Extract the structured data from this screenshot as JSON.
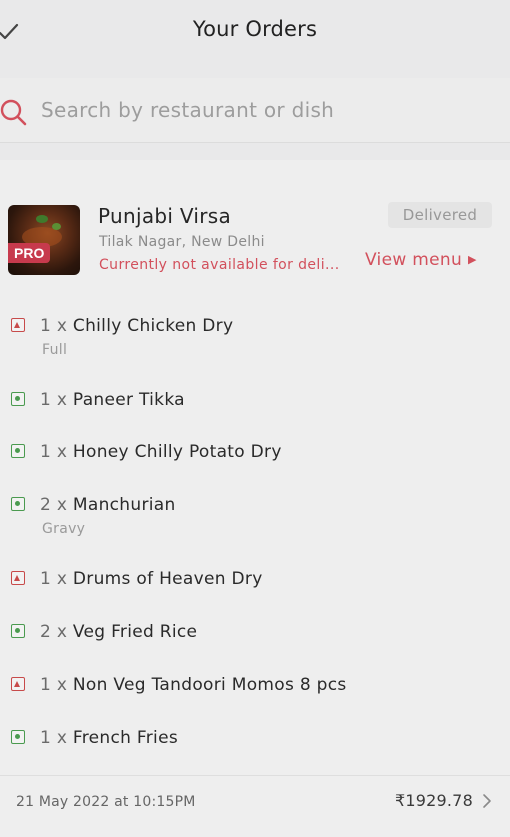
{
  "header": {
    "title": "Your Orders"
  },
  "search": {
    "placeholder": "Search by restaurant or dish"
  },
  "order": {
    "restaurant": {
      "name": "Punjabi Virsa",
      "location": "Tilak Nagar, New Delhi",
      "availability": "Currently not available for deli...",
      "pro_badge": "PRO"
    },
    "status": "Delivered",
    "view_menu": "View menu",
    "items": [
      {
        "qty": "1 x",
        "name": "Chilly Chicken Dry",
        "variant": "Full",
        "type": "non-veg"
      },
      {
        "qty": "1 x",
        "name": "Paneer Tikka",
        "variant": "",
        "type": "veg"
      },
      {
        "qty": "1 x",
        "name": "Honey Chilly Potato Dry",
        "variant": "",
        "type": "veg"
      },
      {
        "qty": "2 x",
        "name": "Manchurian",
        "variant": "Gravy",
        "type": "veg"
      },
      {
        "qty": "1 x",
        "name": "Drums of Heaven Dry",
        "variant": "",
        "type": "non-veg"
      },
      {
        "qty": "2 x",
        "name": "Veg Fried Rice",
        "variant": "",
        "type": "veg"
      },
      {
        "qty": "1 x",
        "name": "Non Veg Tandoori Momos 8 pcs",
        "variant": "",
        "type": "non-veg"
      },
      {
        "qty": "1 x",
        "name": "French Fries",
        "variant": "",
        "type": "veg"
      }
    ],
    "date": "21 May 2022 at 10:15PM",
    "total": "₹1929.78"
  },
  "colors": {
    "accent": "#d2505c",
    "veg": "#4a9a4f",
    "nonveg": "#c74a4a"
  }
}
